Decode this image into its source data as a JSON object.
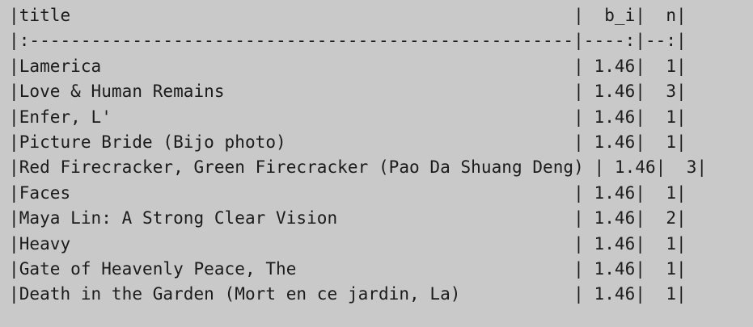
{
  "table": {
    "header": "|title                                                 |  b_i|  n|",
    "separator": "|:-----------------------------------------------------|----:|--:|",
    "rows": [
      "|Lamerica                                              | 1.46|  1|",
      "|Love & Human Remains                                  | 1.46|  3|",
      "|Enfer, L'                                             | 1.46|  1|",
      "|Picture Bride (Bijo photo)                            | 1.46|  1|",
      "|Red Firecracker, Green Firecracker (Pao Da Shuang Deng) | 1.46|  3|",
      "|Faces                                                 | 1.46|  1|",
      "|Maya Lin: A Strong Clear Vision                       | 1.46|  2|",
      "|Heavy                                                 | 1.46|  1|",
      "|Gate of Heavenly Peace, The                           | 1.46|  1|",
      "|Death in the Garden (Mort en ce jardin, La)           | 1.46|  1|"
    ]
  }
}
